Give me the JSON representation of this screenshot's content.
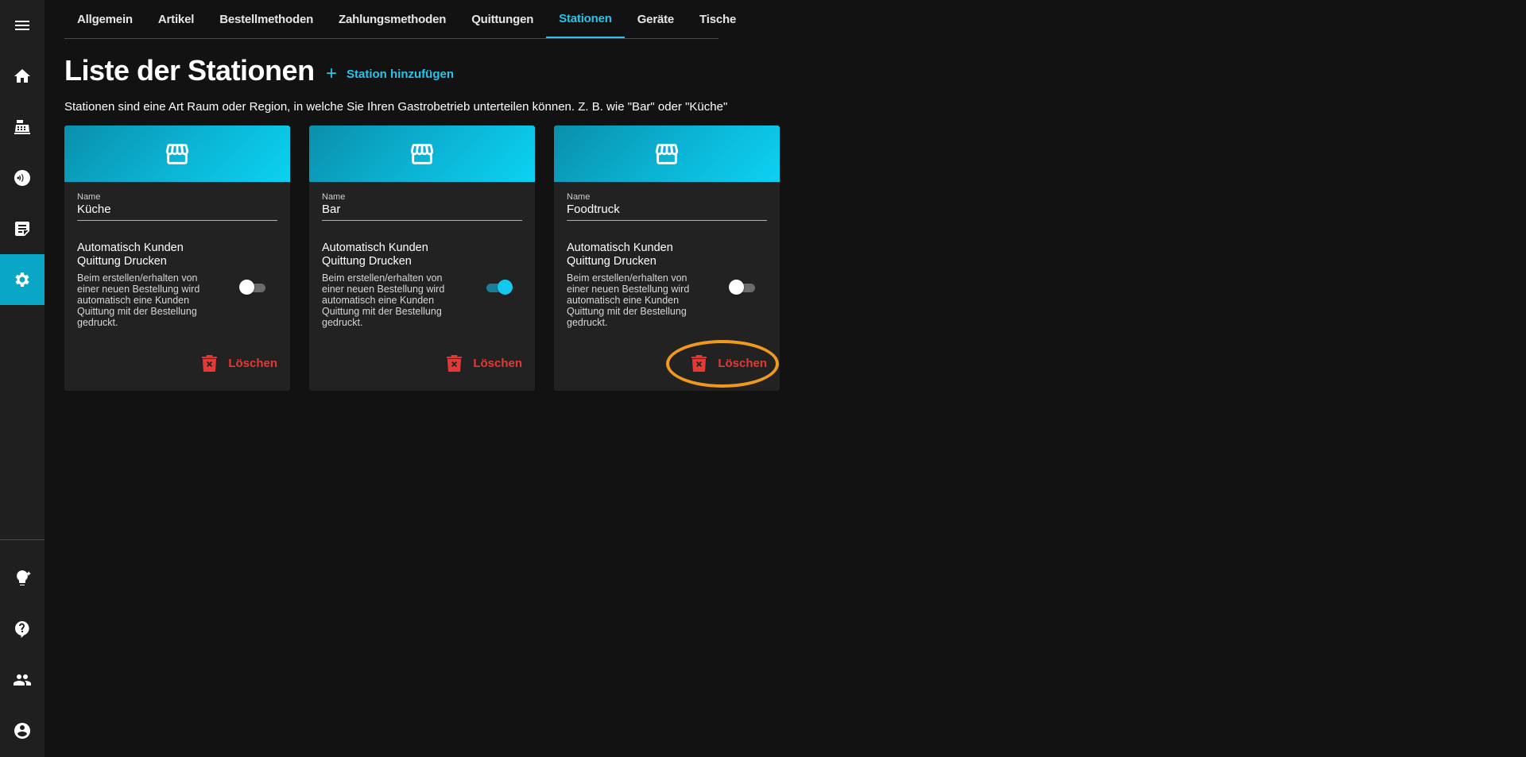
{
  "sidebar": {
    "items": [
      {
        "icon": "menu-icon"
      },
      {
        "icon": "home-icon"
      },
      {
        "icon": "cash-register-icon"
      },
      {
        "icon": "nfc-icon"
      },
      {
        "icon": "order-notes-icon"
      },
      {
        "icon": "gear-icon",
        "active": true
      },
      {
        "icon": "lightbulb-icon"
      },
      {
        "icon": "help-icon"
      },
      {
        "icon": "users-icon"
      },
      {
        "icon": "account-icon"
      }
    ]
  },
  "tabs": [
    {
      "label": "Allgemein"
    },
    {
      "label": "Artikel"
    },
    {
      "label": "Bestellmethoden"
    },
    {
      "label": "Zahlungsmethoden"
    },
    {
      "label": "Quittungen"
    },
    {
      "label": "Stationen",
      "active": true
    },
    {
      "label": "Geräte"
    },
    {
      "label": "Tische"
    }
  ],
  "page": {
    "title": "Liste der Stationen",
    "add_label": "Station hinzufügen",
    "add_icon": "plus-icon",
    "subtitle": "Stationen sind eine Art Raum oder Region, in welche Sie Ihren Gastrobetrieb unterteilen können. Z. B. wie \"Bar\" oder \"Küche\""
  },
  "stations": [
    {
      "icon": "storefront-icon",
      "name_label": "Name",
      "name": "Küche",
      "option_title": "Automatisch Kunden Quittung Drucken",
      "option_desc": "Beim erstellen/erhalten von einer neuen Bestellung wird automatisch eine Kunden Quittung mit der Bestellung gedruckt.",
      "auto_print": false,
      "delete_label": "Löschen"
    },
    {
      "icon": "storefront-icon",
      "name_label": "Name",
      "name": "Bar",
      "option_title": "Automatisch Kunden Quittung Drucken",
      "option_desc": "Beim erstellen/erhalten von einer neuen Bestellung wird automatisch eine Kunden Quittung mit der Bestellung gedruckt.",
      "auto_print": true,
      "delete_label": "Löschen"
    },
    {
      "icon": "storefront-icon",
      "name_label": "Name",
      "name": "Foodtruck",
      "option_title": "Automatisch Kunden Quittung Drucken",
      "option_desc": "Beim erstellen/erhalten von einer neuen Bestellung wird automatisch eine Kunden Quittung mit der Bestellung gedruckt.",
      "auto_print": false,
      "delete_label": "Löschen"
    }
  ],
  "colors": {
    "accent": "#29c4ea",
    "danger": "#e53935",
    "highlight": "#f09a1d",
    "background": "#121212",
    "card": "#222222"
  }
}
